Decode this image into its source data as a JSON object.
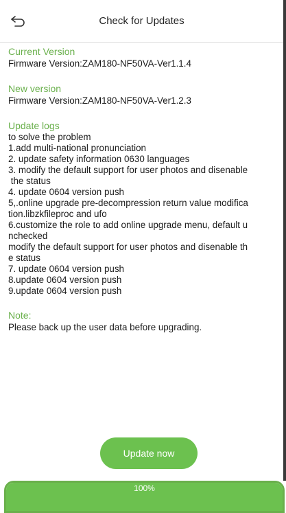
{
  "header": {
    "title": "Check for Updates",
    "back_icon": "back-arrow-icon"
  },
  "current_version": {
    "heading": "Current Version",
    "text": "Firmware Version:ZAM180-NF50VA-Ver1.1.4"
  },
  "new_version": {
    "heading": "New version",
    "text": "Firmware Version:ZAM180-NF50VA-Ver1.2.3"
  },
  "update_logs": {
    "heading": "Update logs",
    "lines": [
      "to solve the problem",
      "1.add multi-national pronunciation",
      "2. update safety information 0630 languages",
      "3. modify the default support for user photos and disenable",
      " the status",
      "4. update 0604 version push",
      "5,.online upgrade pre-decompression return value modifica",
      "tion.libzkfileproc and ufo",
      "6.customize the role to add online upgrade menu, default u",
      "nchecked",
      "modify the default support for user photos and disenable th",
      "e status",
      "7. update 0604 version push",
      "8.update 0604 version push",
      "9.update 0604 version push"
    ]
  },
  "note": {
    "heading": "Note:",
    "text": "Please back up the user data before upgrading."
  },
  "update_button": {
    "label": "Update now"
  },
  "progress": {
    "value": 1.0,
    "label": "100%"
  },
  "colors": {
    "accent": "#6ab04c",
    "button": "#6cc14f",
    "text": "#1a1a1a"
  }
}
